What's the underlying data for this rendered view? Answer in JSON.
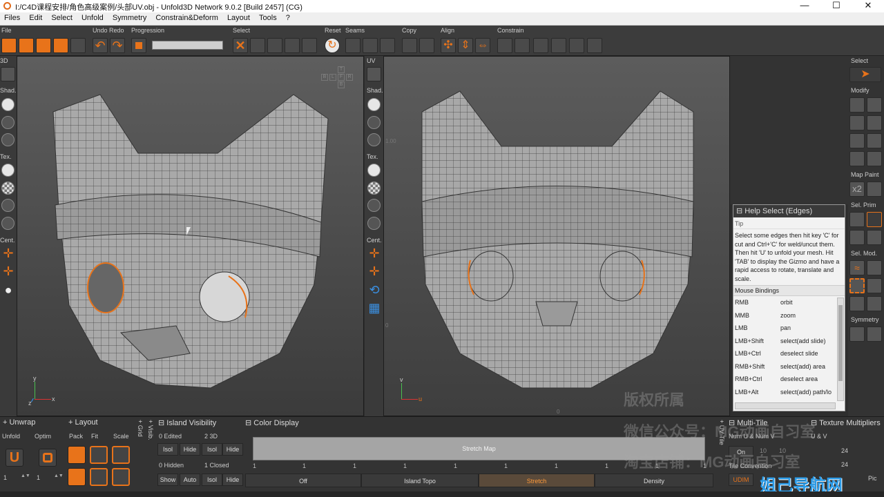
{
  "window": {
    "title": "I:/C4D课程安排/角色高级案例/头部UV.obj - Unfold3D Network 9.0.2 [Build 2457] (CG)",
    "min": "—",
    "max": "☐",
    "close": "✕"
  },
  "menu": [
    "Files",
    "Edit",
    "Select",
    "Unfold",
    "Symmetry",
    "Constrain&Deform",
    "Layout",
    "Tools",
    "?"
  ],
  "toolbar_groups": {
    "file": "File",
    "undo": "Undo Redo",
    "progression": "Progression",
    "select": "Select",
    "reset": "Reset",
    "seams": "Seams",
    "copy": "Copy",
    "align": "Align",
    "constrain": "Constrain"
  },
  "left_3d": {
    "view": "3D",
    "shad": "Shad.",
    "tex": "Tex.",
    "cent": "Cent."
  },
  "left_uv": {
    "view": "UV",
    "shad": "Shad.",
    "tex": "Tex.",
    "cent": "Cent."
  },
  "viewcube": [
    "T",
    "B",
    "L",
    "F",
    "R"
  ],
  "gizmo3d": {
    "y": "y",
    "x": "x",
    "z": "z"
  },
  "gizmouv": {
    "v": "v",
    "u": "u"
  },
  "uv_marks": {
    "top_left": "1.00",
    "bottom_left": "0",
    "bottom": "0"
  },
  "right_panel": {
    "select": "Select",
    "modify": "Modify",
    "map_paint": "Map Paint",
    "x2": "x2",
    "sel_prim": "Sel. Prim",
    "sel_mod": "Sel. Mod.",
    "symmetry": "Symmetry"
  },
  "help": {
    "title": "Help Select (Edges)",
    "tip_label": "Tip",
    "tip": "Select some edges then hit key 'C' for cut and Ctrl+'C' for weld/uncut them. Then hit 'U' to unfold your mesh. Hit 'TAB' to display the Gizmo and have a rapid access to rotate, translate and scale.",
    "mouse_label": "Mouse Bindings",
    "bindings": [
      [
        "RMB",
        "orbit"
      ],
      [
        "MMB",
        "zoom"
      ],
      [
        "LMB",
        "pan"
      ],
      [
        "LMB+Shift",
        "select(add slide)"
      ],
      [
        "LMB+Ctrl",
        "deselect slide"
      ],
      [
        "RMB+Shift",
        "select(add) area"
      ],
      [
        "RMB+Ctrl",
        "deselect area"
      ],
      [
        "LMB+Alt",
        "select(add) path/lo"
      ]
    ]
  },
  "bottom": {
    "unwrap": "Unwrap",
    "unfold": "Unfold",
    "optim": "Optim",
    "unfold_val": "1",
    "optim_val": "1",
    "layout": "Layout",
    "pack": "Pack",
    "fit": "Fit",
    "scale": "Scale",
    "grid": "Grid",
    "visib": "Visib.",
    "island_vis": "Island Visibility",
    "edited": "0 Edited",
    "three_d": "2 3D",
    "hidden": "0 Hidden",
    "closed": "1 Closed",
    "isol": "Isol",
    "hide": "Hide",
    "show": "Show",
    "auto": "Auto",
    "color_display": "Color Display",
    "stretch_map": "Stretch Map",
    "ticks": [
      "1",
      "1",
      "1",
      "1",
      "1",
      "1",
      "1",
      "1",
      "1",
      "1"
    ],
    "tabs": [
      "Off",
      "Island Topo",
      "Stretch",
      "Density"
    ],
    "selected_tab": "Stretch",
    "uv_tile": "UV Tile",
    "multi_tile": "Multi-Tile",
    "num_uv": "Num U & Num V",
    "nu": "10",
    "nv": "10",
    "on": "On",
    "tile_conv": "Tile Convention",
    "udim": "UDIM",
    "tex_mult": "Texture Multipliers",
    "u_v": "U & V",
    "m1": "24",
    "m2": "24",
    "pic": "Pic"
  },
  "watermark": [
    "版权所属",
    "微信公众号：MG动画自习室",
    "淘宝店铺：MG动画自习室",
    "姐己导航网"
  ],
  "colors": {
    "accent": "#e8731a",
    "bg": "#2e2e2e",
    "panel": "#3c3c3c"
  }
}
